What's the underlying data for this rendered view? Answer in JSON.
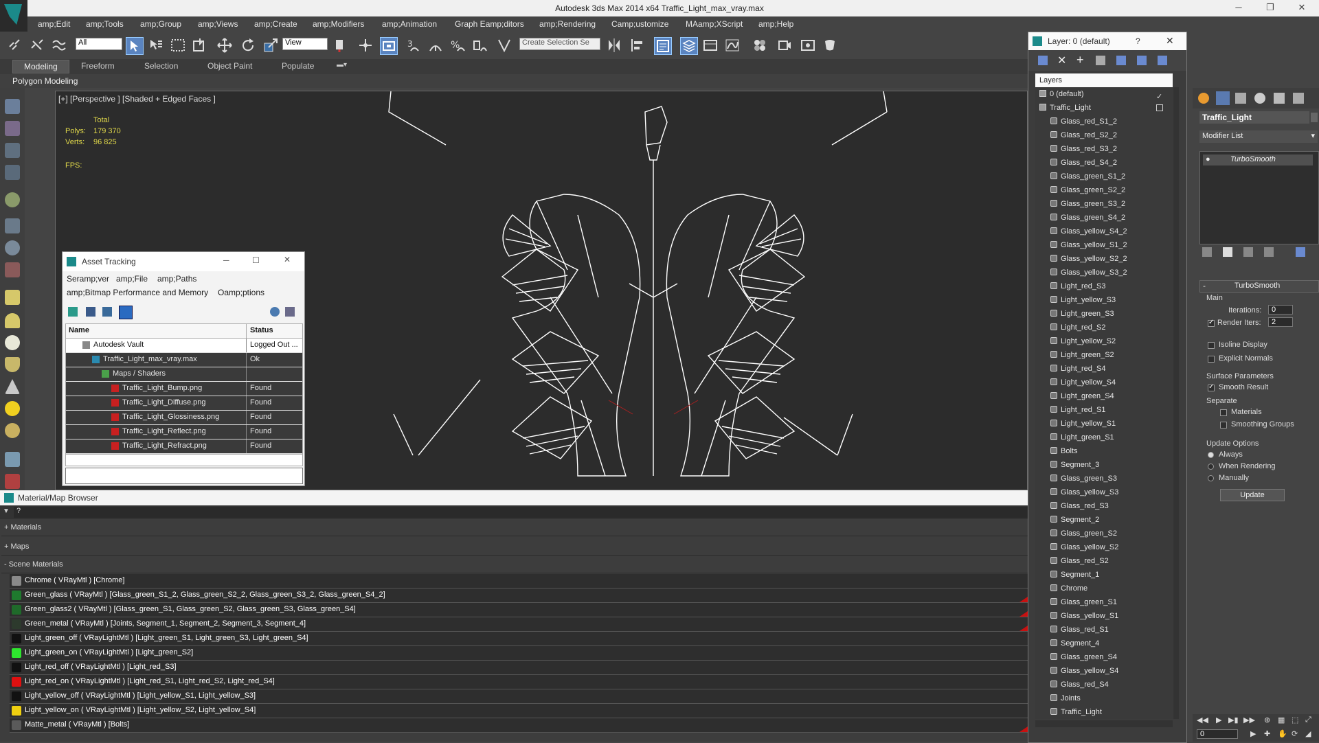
{
  "titlebar": {
    "title": "Autodesk 3ds Max  2014 x64    Traffic_Light_max_vray.max",
    "minimize": "─",
    "restore": "❐",
    "close": "✕"
  },
  "menubar": {
    "items": [
      "amp;Edit",
      "amp;Tools",
      "amp;Group",
      "amp;Views",
      "amp;Create",
      "amp;Modifiers",
      "amp;Animation",
      "Graph Eamp;ditors",
      "amp;Rendering",
      "Camp;ustomize",
      "MAamp;XScript",
      "amp;Help"
    ]
  },
  "toolbar": {
    "selection_filter": "All",
    "coord_system": "View",
    "selection_set_placeholder": "Create Selection Se"
  },
  "ribbon": {
    "tabs": [
      "Modeling",
      "Freeform",
      "Selection",
      "Object Paint",
      "Populate"
    ],
    "active_tab": "Modeling",
    "panel_label": "Polygon Modeling"
  },
  "viewport": {
    "label": "[+] [Perspective ] [Shaded + Edged Faces ]",
    "stats": {
      "total_label": "Total",
      "polys_label": "Polys:",
      "polys_value": "179 370",
      "verts_label": "Verts:",
      "verts_value": "96 825",
      "fps_label": "FPS:"
    }
  },
  "asset_tracking": {
    "title": "Asset Tracking",
    "menu_row1": [
      "Seramp;ver",
      "amp;File",
      "amp;Paths"
    ],
    "menu_row2": [
      "amp;Bitmap Performance and Memory",
      "Oamp;ptions"
    ],
    "columns": [
      "Name",
      "Status"
    ],
    "rows": [
      {
        "name": "Autodesk Vault",
        "status": "Logged Out ...",
        "indent": 1
      },
      {
        "name": "Traffic_Light_max_vray.max",
        "status": "Ok",
        "indent": 2
      },
      {
        "name": "Maps / Shaders",
        "status": "",
        "indent": 3
      },
      {
        "name": "Traffic_Light_Bump.png",
        "status": "Found",
        "indent": 4
      },
      {
        "name": "Traffic_Light_Diffuse.png",
        "status": "Found",
        "indent": 4
      },
      {
        "name": "Traffic_Light_Glossiness.png",
        "status": "Found",
        "indent": 4
      },
      {
        "name": "Traffic_Light_Reflect.png",
        "status": "Found",
        "indent": 4
      },
      {
        "name": "Traffic_Light_Refract.png",
        "status": "Found",
        "indent": 4
      }
    ]
  },
  "material_browser": {
    "title": "Material/Map Browser",
    "search_value": "?",
    "groups": [
      "+ Materials",
      "+ Maps",
      "- Scene Materials"
    ],
    "materials": [
      {
        "text": "Chrome  ( VRayMtl ) [Chrome]",
        "swatch": "#8a8a8a",
        "flag": false
      },
      {
        "text": "Green_glass  ( VRayMtl ) [Glass_green_S1_2, Glass_green_S2_2, Glass_green_S3_2, Glass_green_S4_2]",
        "swatch": "#1f7a2e",
        "flag": true
      },
      {
        "text": "Green_glass2  ( VRayMtl ) [Glass_green_S1, Glass_green_S2, Glass_green_S3, Glass_green_S4]",
        "swatch": "#1f6a2a",
        "flag": true
      },
      {
        "text": "Green_metal  ( VRayMtl ) [Joints, Segment_1, Segment_2, Segment_3, Segment_4]",
        "swatch": "#2d3a2d",
        "flag": true
      },
      {
        "text": "Light_green_off  ( VRayLightMtl ) [Light_green_S1, Light_green_S3, Light_green_S4]",
        "swatch": "#111111",
        "flag": false
      },
      {
        "text": "Light_green_on  ( VRayLightMtl ) [Light_green_S2]",
        "swatch": "#2ee62e",
        "flag": false
      },
      {
        "text": "Light_red_off  ( VRayLightMtl ) [Light_red_S3]",
        "swatch": "#111111",
        "flag": false
      },
      {
        "text": "Light_red_on  ( VRayLightMtl ) [Light_red_S1, Light_red_S2, Light_red_S4]",
        "swatch": "#e01010",
        "flag": false
      },
      {
        "text": "Light_yellow_off  ( VRayLightMtl ) [Light_yellow_S1, Light_yellow_S3]",
        "swatch": "#111111",
        "flag": false
      },
      {
        "text": "Light_yellow_on  ( VRayLightMtl ) [Light_yellow_S2, Light_yellow_S4]",
        "swatch": "#f0d010",
        "flag": false
      },
      {
        "text": "Matte_metal  ( VRayMtl ) [Bolts]",
        "swatch": "#5a5a5a",
        "flag": true
      }
    ]
  },
  "layers": {
    "title": "Layer: 0 (default)",
    "help": "?",
    "close": "✕",
    "header": "Layers",
    "items": [
      {
        "label": "0 (default)",
        "level": 0
      },
      {
        "label": "Traffic_Light",
        "level": 0
      },
      {
        "label": "Glass_red_S1_2",
        "level": 1
      },
      {
        "label": "Glass_red_S2_2",
        "level": 1
      },
      {
        "label": "Glass_red_S3_2",
        "level": 1
      },
      {
        "label": "Glass_red_S4_2",
        "level": 1
      },
      {
        "label": "Glass_green_S1_2",
        "level": 1
      },
      {
        "label": "Glass_green_S2_2",
        "level": 1
      },
      {
        "label": "Glass_green_S3_2",
        "level": 1
      },
      {
        "label": "Glass_green_S4_2",
        "level": 1
      },
      {
        "label": "Glass_yellow_S4_2",
        "level": 1
      },
      {
        "label": "Glass_yellow_S1_2",
        "level": 1
      },
      {
        "label": "Glass_yellow_S2_2",
        "level": 1
      },
      {
        "label": "Glass_yellow_S3_2",
        "level": 1
      },
      {
        "label": "Light_red_S3",
        "level": 1
      },
      {
        "label": "Light_yellow_S3",
        "level": 1
      },
      {
        "label": "Light_green_S3",
        "level": 1
      },
      {
        "label": "Light_red_S2",
        "level": 1
      },
      {
        "label": "Light_yellow_S2",
        "level": 1
      },
      {
        "label": "Light_green_S2",
        "level": 1
      },
      {
        "label": "Light_red_S4",
        "level": 1
      },
      {
        "label": "Light_yellow_S4",
        "level": 1
      },
      {
        "label": "Light_green_S4",
        "level": 1
      },
      {
        "label": "Light_red_S1",
        "level": 1
      },
      {
        "label": "Light_yellow_S1",
        "level": 1
      },
      {
        "label": "Light_green_S1",
        "level": 1
      },
      {
        "label": "Bolts",
        "level": 1
      },
      {
        "label": "Segment_3",
        "level": 1
      },
      {
        "label": "Glass_green_S3",
        "level": 1
      },
      {
        "label": "Glass_yellow_S3",
        "level": 1
      },
      {
        "label": "Glass_red_S3",
        "level": 1
      },
      {
        "label": "Segment_2",
        "level": 1
      },
      {
        "label": "Glass_green_S2",
        "level": 1
      },
      {
        "label": "Glass_yellow_S2",
        "level": 1
      },
      {
        "label": "Glass_red_S2",
        "level": 1
      },
      {
        "label": "Segment_1",
        "level": 1
      },
      {
        "label": "Chrome",
        "level": 1
      },
      {
        "label": "Glass_green_S1",
        "level": 1
      },
      {
        "label": "Glass_yellow_S1",
        "level": 1
      },
      {
        "label": "Glass_red_S1",
        "level": 1
      },
      {
        "label": "Segment_4",
        "level": 1
      },
      {
        "label": "Glass_green_S4",
        "level": 1
      },
      {
        "label": "Glass_yellow_S4",
        "level": 1
      },
      {
        "label": "Glass_red_S4",
        "level": 1
      },
      {
        "label": "Joints",
        "level": 1
      },
      {
        "label": "Traffic_Light",
        "level": 1
      }
    ]
  },
  "command_panel": {
    "object_name": "Traffic_Light",
    "modifier_list": "Modifier List",
    "stack_item": "TurboSmooth",
    "rollout_title": "TurboSmooth",
    "main_label": "Main",
    "iterations_label": "Iterations:",
    "iterations_value": "0",
    "render_iters_label": "Render Iters:",
    "render_iters_value": "2",
    "isoline_label": "Isoline Display",
    "explicit_normals_label": "Explicit Normals",
    "surface_params_label": "Surface Parameters",
    "smooth_result_label": "Smooth Result",
    "separate_label": "Separate",
    "materials_label": "Materials",
    "smoothing_groups_label": "Smoothing Groups",
    "update_options_label": "Update Options",
    "always_label": "Always",
    "when_rendering_label": "When Rendering",
    "manually_label": "Manually",
    "update_button": "Update",
    "frame_value": "0"
  }
}
